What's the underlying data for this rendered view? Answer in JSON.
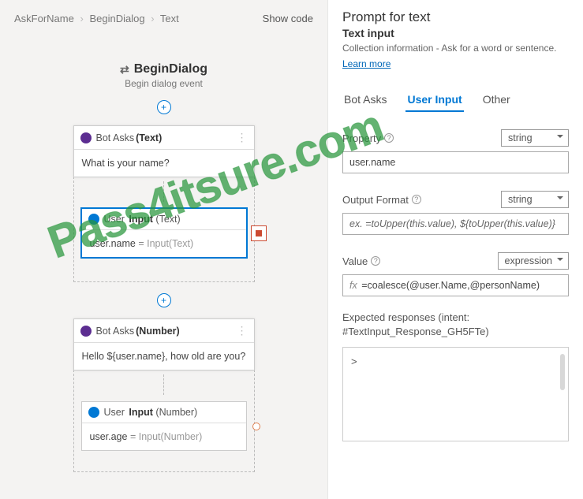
{
  "breadcrumbs": [
    "AskForName",
    "BeginDialog",
    "Text"
  ],
  "show_code_label": "Show code",
  "flow": {
    "trigger_title": "BeginDialog",
    "trigger_subtitle": "Begin dialog event",
    "nodes": {
      "botasks1": {
        "head_label": "Bot Asks",
        "head_type": "(Text)",
        "body": "What is your name?"
      },
      "userinput1": {
        "head_label": "User",
        "head_strong": "Input",
        "head_type": "(Text)",
        "lhs": "user.name",
        "eq": " = ",
        "rhs": "Input(Text)"
      },
      "botasks2": {
        "head_label": "Bot Asks",
        "head_type": "(Number)",
        "body": "Hello ${user.name}, how old are you?"
      },
      "userinput2": {
        "head_label": "User",
        "head_strong": "Input",
        "head_type": "(Number)",
        "lhs": "user.age",
        "eq": " = ",
        "rhs": "Input(Number)"
      }
    }
  },
  "panel": {
    "title": "Prompt for text",
    "subtitle": "Text input",
    "description": "Collection information - Ask for a word or sentence.",
    "learn_more": "Learn more",
    "tabs": {
      "bot_asks": "Bot Asks",
      "user_input": "User Input",
      "other": "Other"
    },
    "property": {
      "label": "Property",
      "type": "string",
      "value": "user.name"
    },
    "output_format": {
      "label": "Output Format",
      "type": "string",
      "example": "ex. =toUpper(this.value), ${toUpper(this.value)}"
    },
    "value": {
      "label": "Value",
      "type": "expression",
      "prefix": "fx",
      "text": " =coalesce(@user.Name,@personName)"
    },
    "expected": {
      "label": "Expected responses (intent: #TextInput_Response_GH5FTe)",
      "content": ">"
    }
  },
  "watermark": "Pass4itsure.com"
}
